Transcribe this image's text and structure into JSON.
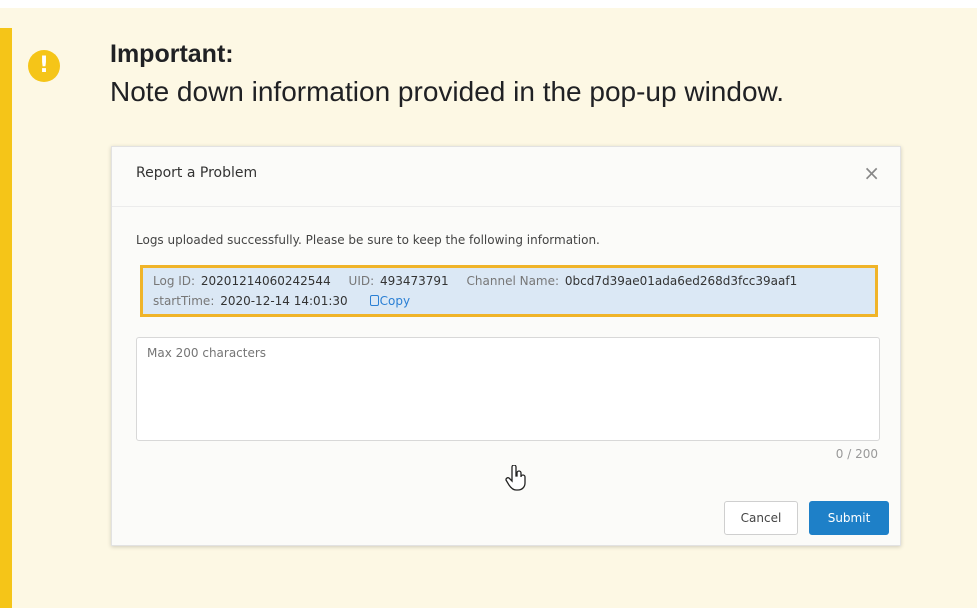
{
  "callout": {
    "icon": "exclamation-icon",
    "icon_glyph": "!",
    "title": "Important:",
    "text": "Note down information provided in the pop-up window.",
    "accent_color": "#f5c518",
    "background_color": "#fdf8e4"
  },
  "dialog": {
    "title": "Report a Problem",
    "close_glyph": "×",
    "message": "Logs uploaded successfully. Please be sure to keep the following information.",
    "info": {
      "log_id_label": "Log ID:",
      "log_id_value": "20201214060242544",
      "uid_label": "UID:",
      "uid_value": "493473791",
      "channel_label": "Channel Name:",
      "channel_value": "0bcd7d39ae01ada6ed268d3fcc39aaf1",
      "start_label": "startTime:",
      "start_value": "2020-12-14 14:01:30",
      "copy_label": "Copy",
      "highlight_color": "#f0b429"
    },
    "textarea_placeholder": "Max 200 characters",
    "counter": "0 / 200",
    "cancel_label": "Cancel",
    "submit_label": "Submit",
    "submit_color": "#1e80c8"
  }
}
